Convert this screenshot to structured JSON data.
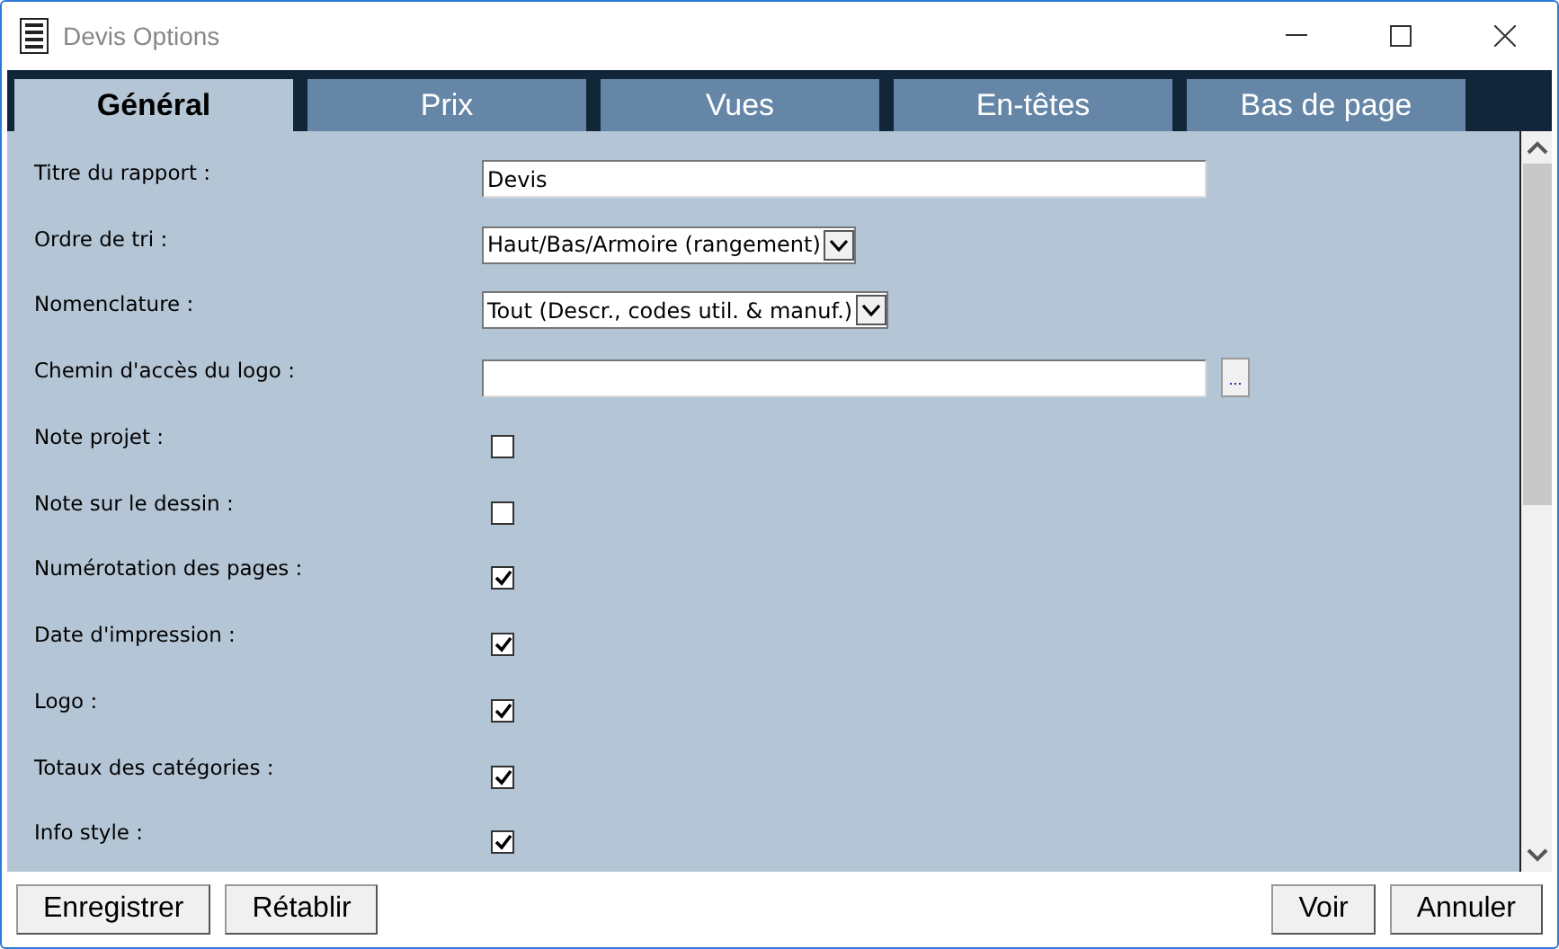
{
  "window": {
    "title": "Devis Options"
  },
  "tabs": [
    {
      "label": "Général",
      "selected": true
    },
    {
      "label": "Prix",
      "selected": false
    },
    {
      "label": "Vues",
      "selected": false
    },
    {
      "label": "En-têtes",
      "selected": false
    },
    {
      "label": "Bas de page",
      "selected": false
    }
  ],
  "fields": [
    {
      "kind": "text",
      "label": "Titre du rapport :",
      "value": "Devis"
    },
    {
      "kind": "select",
      "label": "Ordre de tri :",
      "value": "Haut/Bas/Armoire (rangement)"
    },
    {
      "kind": "select",
      "label": "Nomenclature :",
      "value": "Tout (Descr., codes util. & manuf.)"
    },
    {
      "kind": "file",
      "label": "Chemin d'accès du logo :",
      "button": "..."
    },
    {
      "kind": "checkbox",
      "label": "Note projet :",
      "checked": false
    },
    {
      "kind": "checkbox",
      "label": "Note sur le dessin :",
      "checked": false
    },
    {
      "kind": "checkbox",
      "label": "Numérotation des pages :",
      "checked": true
    },
    {
      "kind": "checkbox",
      "label": "Date d'impression :",
      "checked": true
    },
    {
      "kind": "checkbox",
      "label": "Logo :",
      "checked": true
    },
    {
      "kind": "checkbox",
      "label": "Totaux des catégories :",
      "checked": true
    },
    {
      "kind": "checkbox",
      "label": "Info style :",
      "checked": true
    }
  ],
  "buttons_left": [
    "Enregistrer",
    "Rétablir"
  ],
  "buttons_right": [
    "Voir",
    "Annuler"
  ]
}
